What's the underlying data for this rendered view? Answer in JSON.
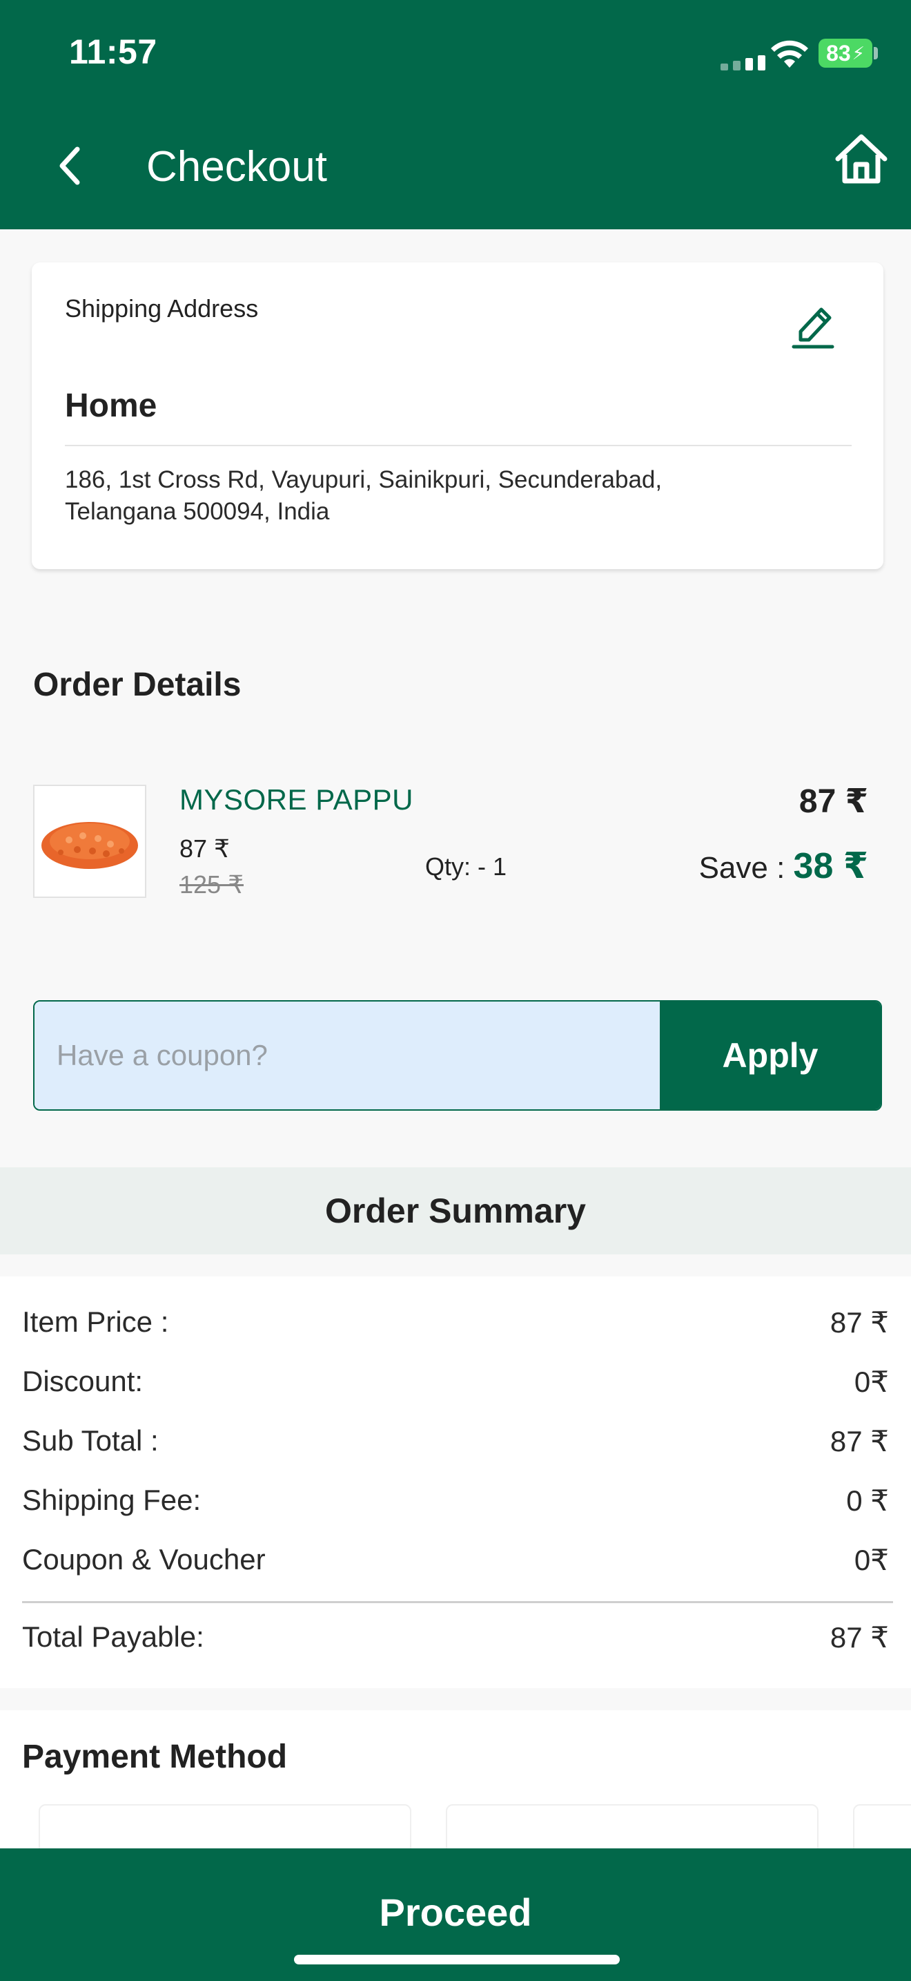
{
  "status_bar": {
    "time": "11:57",
    "battery": "83"
  },
  "header": {
    "title": "Checkout",
    "back_icon": "chevron-left-icon",
    "home_icon": "home-icon"
  },
  "shipping": {
    "label": "Shipping Address",
    "edit_icon": "pencil-icon",
    "name": "Home",
    "address_line1": "186, 1st Cross Rd, Vayupuri, Sainikpuri, Secunderabad,",
    "address_line2": "Telangana 500094, India"
  },
  "order_details": {
    "title": "Order Details",
    "items": [
      {
        "name": "MYSORE PAPPU",
        "price": "87 ₹",
        "mrp": "125 ₹",
        "qty_label": "Qty: -  1",
        "line_total": "87 ₹",
        "save_label": "Save : ",
        "save_amount": "38 ₹"
      }
    ]
  },
  "coupon": {
    "placeholder": "Have a coupon?",
    "value": "",
    "apply_label": "Apply"
  },
  "summary": {
    "title": "Order Summary",
    "rows": [
      {
        "label": "Item Price :",
        "value": "87 ₹"
      },
      {
        "label": "Discount:",
        "value": "0₹"
      },
      {
        "label": "Sub Total :",
        "value": "87 ₹"
      },
      {
        "label": "Shipping Fee:",
        "value": "0 ₹"
      },
      {
        "label": "Coupon & Voucher",
        "value": "0₹"
      }
    ],
    "total": {
      "label": "Total Payable:",
      "value": "87 ₹"
    }
  },
  "payment": {
    "title": "Payment Method"
  },
  "footer": {
    "proceed_label": "Proceed"
  },
  "colors": {
    "brand": "#02684a",
    "coupon_bg": "#deedfc",
    "summary_header_bg": "#ebf0ee"
  }
}
